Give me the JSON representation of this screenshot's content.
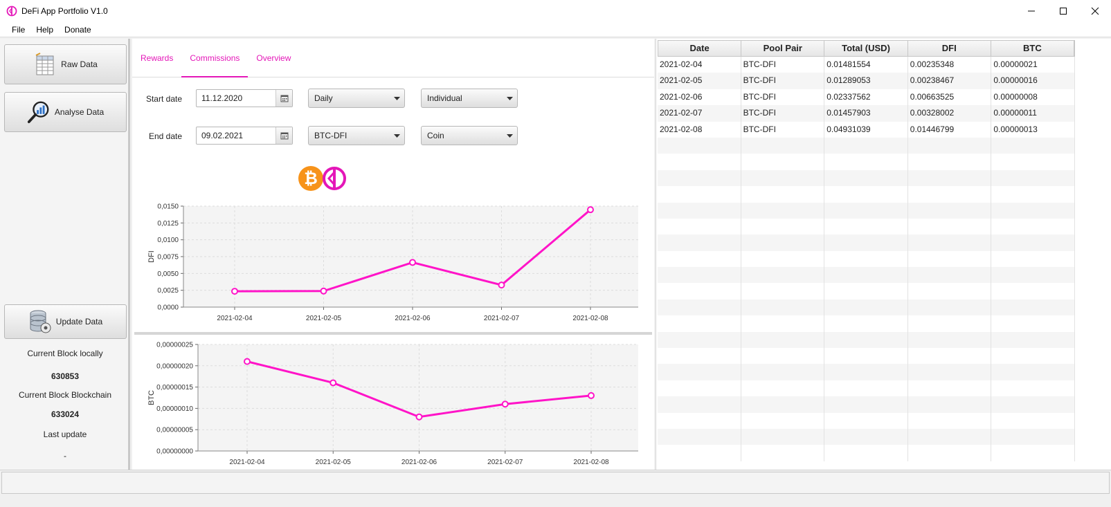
{
  "window": {
    "title": "DeFi App Portfolio V1.0"
  },
  "menu": {
    "items": [
      "File",
      "Help",
      "Donate"
    ]
  },
  "sidebar": {
    "raw_data": "Raw Data",
    "analyse_data": "Analyse Data",
    "update_data": "Update Data",
    "current_block_local_label": "Current Block locally",
    "current_block_local": "630853",
    "current_block_chain_label": "Current Block Blockchain",
    "current_block_chain": "633024",
    "last_update_label": "Last update",
    "last_update": "-"
  },
  "tabs": {
    "rewards": "Rewards",
    "commissions": "Commissions",
    "overview": "Overview",
    "active": "Commissions"
  },
  "filters": {
    "start_label": "Start date",
    "start_value": "11.12.2020",
    "end_label": "End date",
    "end_value": "09.02.2021",
    "interval": "Daily",
    "mode": "Individual",
    "pool_pair": "BTC-DFI",
    "unit": "Coin"
  },
  "colors": {
    "accent": "#e417b8",
    "btc_orange": "#f7931a",
    "line": "#ff14c8"
  },
  "chart_data": [
    {
      "type": "line",
      "ylabel": "DFI",
      "x": [
        "2021-02-04",
        "2021-02-05",
        "2021-02-06",
        "2021-02-07",
        "2021-02-08"
      ],
      "values": [
        0.00235348,
        0.00238467,
        0.00663525,
        0.00328002,
        0.01446799
      ],
      "ylim": [
        0,
        0.015
      ],
      "yticks": [
        "0,0000",
        "0,0025",
        "0,0050",
        "0,0075",
        "0,0100",
        "0,0125",
        "0,0150"
      ],
      "grid": true
    },
    {
      "type": "line",
      "ylabel": "BTC",
      "x": [
        "2021-02-04",
        "2021-02-05",
        "2021-02-06",
        "2021-02-07",
        "2021-02-08"
      ],
      "values": [
        2.1e-07,
        1.6e-07,
        8e-08,
        1.1e-07,
        1.3e-07
      ],
      "ylim": [
        0,
        2.5e-07
      ],
      "yticks": [
        "0,00000000",
        "0,00000005",
        "0,00000010",
        "0,00000015",
        "0,00000020",
        "0,00000025"
      ],
      "grid": true
    }
  ],
  "table": {
    "columns": [
      "Date",
      "Pool Pair",
      "Total (USD)",
      "DFI",
      "BTC"
    ],
    "rows": [
      [
        "2021-02-04",
        "BTC-DFI",
        "0.01481554",
        "0.00235348",
        "0.00000021"
      ],
      [
        "2021-02-05",
        "BTC-DFI",
        "0.01289053",
        "0.00238467",
        "0.00000016"
      ],
      [
        "2021-02-06",
        "BTC-DFI",
        "0.02337562",
        "0.00663525",
        "0.00000008"
      ],
      [
        "2021-02-07",
        "BTC-DFI",
        "0.01457903",
        "0.00328002",
        "0.00000011"
      ],
      [
        "2021-02-08",
        "BTC-DFI",
        "0.04931039",
        "0.01446799",
        "0.00000013"
      ]
    ]
  }
}
